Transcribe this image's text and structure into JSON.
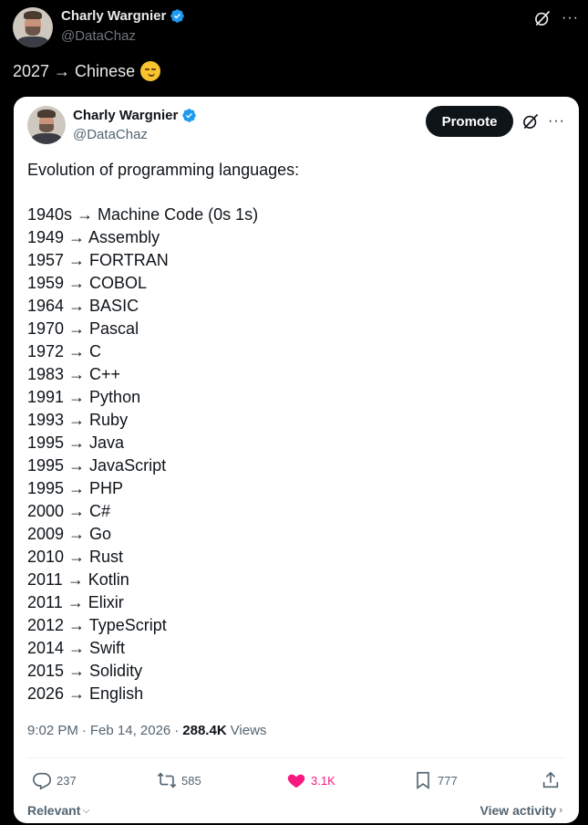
{
  "outer_tweet": {
    "author_name": "Charly Wargnier",
    "author_handle": "@DataChaz",
    "text": "2027 → Chinese",
    "emoji": "smirking-face-emoji"
  },
  "quoted_tweet": {
    "author_name": "Charly Wargnier",
    "author_handle": "@DataChaz",
    "promote_label": "Promote",
    "intro": "Evolution of programming languages:",
    "languages": [
      "1940s → Machine Code (0s 1s)",
      "1949 → Assembly",
      "1957 → FORTRAN",
      "1959 → COBOL",
      "1964 → BASIC",
      "1970 → Pascal",
      "1972 → C",
      "1983 → C++",
      "1991 → Python",
      "1993 → Ruby",
      "1995 → Java",
      "1995 → JavaScript",
      "1995 → PHP",
      "2000 → C#",
      "2009 → Go",
      "2010 → Rust",
      "2011 → Kotlin",
      "2011 → Elixir",
      "2012 → TypeScript",
      "2014 → Swift",
      "2015 → Solidity",
      "2026 → English"
    ],
    "time": "9:02 PM",
    "date": "Feb 14, 2026",
    "views_count": "288.4K",
    "views_label": "Views",
    "replies": "237",
    "reposts": "585",
    "likes": "3.1K",
    "bookmarks": "777",
    "relevant_label": "Relevant",
    "view_activity_label": "View activity"
  },
  "colors": {
    "background": "#000000",
    "card": "#ffffff",
    "verified": "#1d9bf0",
    "like": "#f91880",
    "muted": "#536471"
  },
  "icons": [
    "verified-badge-icon",
    "grok-icon",
    "more-icon",
    "reply-icon",
    "repost-icon",
    "like-icon",
    "bookmark-icon",
    "share-icon"
  ]
}
